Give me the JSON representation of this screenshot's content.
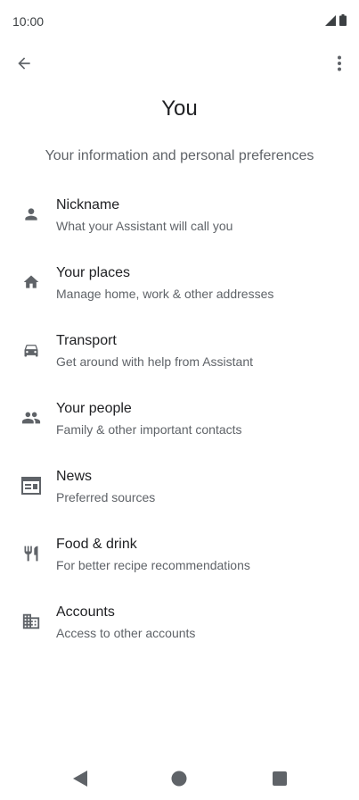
{
  "status": {
    "time": "10:00"
  },
  "header": {
    "title": "You",
    "subtitle": "Your information and personal preferences"
  },
  "icons": {
    "back": "arrow-back-icon",
    "more": "more-vert-icon",
    "signal": "signal-icon",
    "battery": "battery-icon"
  },
  "items": [
    {
      "title": "Nickname",
      "desc": "What your Assistant will call you",
      "icon": "person-icon"
    },
    {
      "title": "Your places",
      "desc": "Manage home, work & other addresses",
      "icon": "home-icon"
    },
    {
      "title": "Transport",
      "desc": "Get around with help from Assistant",
      "icon": "car-icon"
    },
    {
      "title": "Your people",
      "desc": "Family & other important contacts",
      "icon": "people-icon"
    },
    {
      "title": "News",
      "desc": "Preferred sources",
      "icon": "news-icon"
    },
    {
      "title": "Food & drink",
      "desc": "For better recipe recommendations",
      "icon": "restaurant-icon"
    },
    {
      "title": "Accounts",
      "desc": "Access to other accounts",
      "icon": "business-icon"
    }
  ],
  "colors": {
    "text": "#202124",
    "secondary": "#5f6368",
    "icon": "#5f6368"
  }
}
